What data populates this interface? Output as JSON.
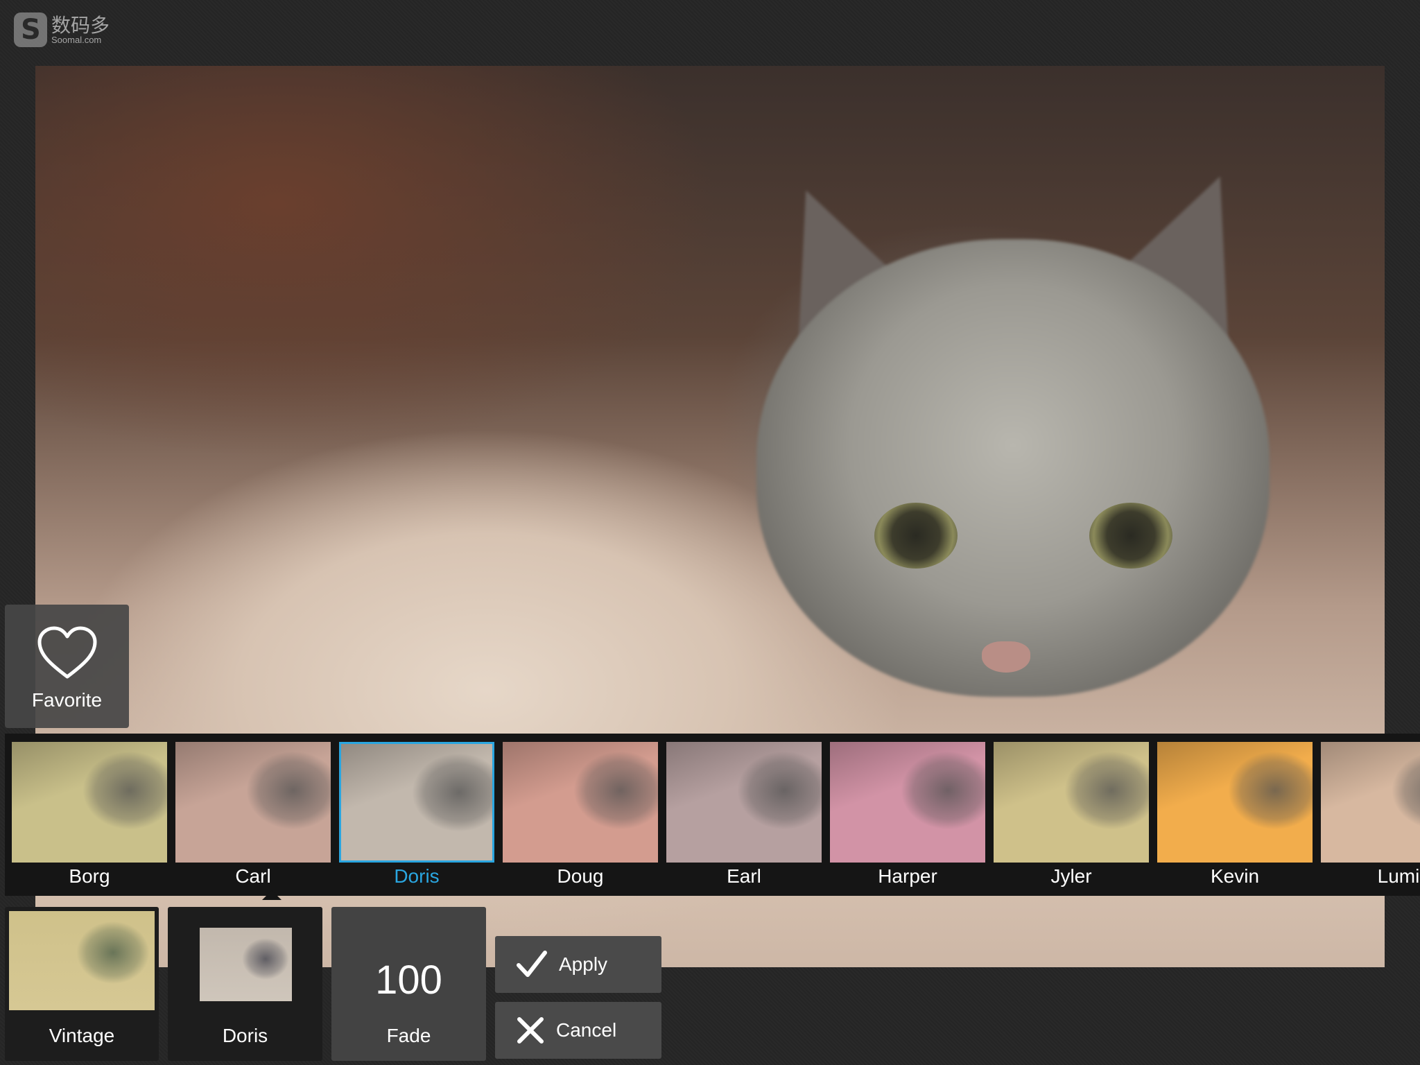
{
  "watermark": {
    "brand_cn": "数码多",
    "brand_en": "Soomal.com"
  },
  "favorite": {
    "label": "Favorite"
  },
  "filters": [
    {
      "name": "Borg",
      "tint": "#c9c08a",
      "selected": false
    },
    {
      "name": "Carl",
      "tint": "#c7a497",
      "selected": false
    },
    {
      "name": "Doris",
      "tint": "#c2b8ad",
      "selected": true
    },
    {
      "name": "Doug",
      "tint": "#d39c8f",
      "selected": false
    },
    {
      "name": "Earl",
      "tint": "#b6a0a0",
      "selected": false
    },
    {
      "name": "Harper",
      "tint": "#d293a6",
      "selected": false
    },
    {
      "name": "Jyler",
      "tint": "#cfc18a",
      "selected": false
    },
    {
      "name": "Kevin",
      "tint": "#f2ad4c",
      "selected": false
    },
    {
      "name": "Lumi",
      "tint": "#d7b8a0",
      "selected": false
    }
  ],
  "panels": {
    "category_label": "Vintage",
    "current_filter_label": "Doris",
    "fade_value": "100",
    "fade_label": "Fade"
  },
  "actions": {
    "apply": "Apply",
    "cancel": "Cancel"
  },
  "colors": {
    "accent": "#2aa6e0"
  }
}
